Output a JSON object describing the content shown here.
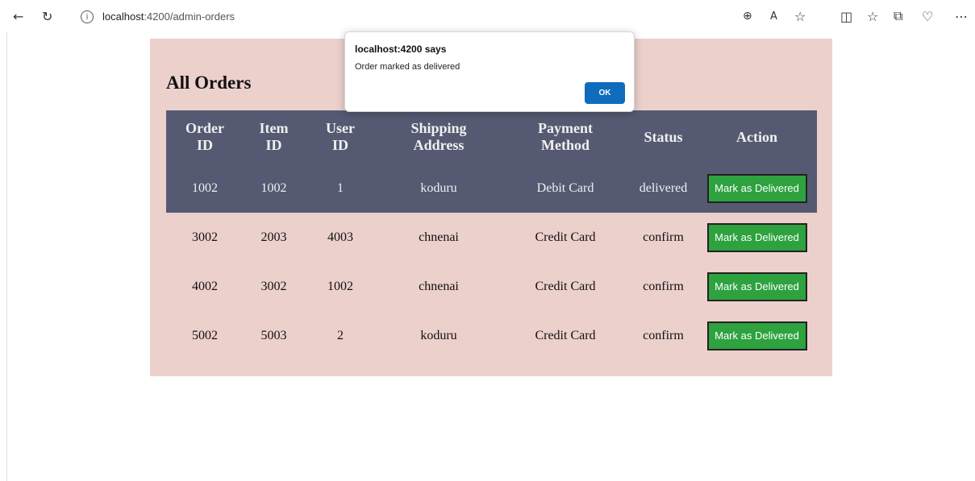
{
  "browser": {
    "url_host": "localhost",
    "url_rest": ":4200/admin-orders"
  },
  "page": {
    "heading": "All Orders"
  },
  "table": {
    "headers": [
      {
        "line1": "Order",
        "line2": "ID"
      },
      {
        "line1": "Item",
        "line2": "ID"
      },
      {
        "line1": "User",
        "line2": "ID"
      },
      {
        "line1": "Shipping",
        "line2": "Address"
      },
      {
        "line1": "Payment",
        "line2": "Method"
      },
      {
        "line1": "Status",
        "line2": ""
      },
      {
        "line1": "Action",
        "line2": ""
      }
    ],
    "rows": [
      {
        "order_id": "1002",
        "item_id": "1002",
        "user_id": "1",
        "address": "koduru",
        "payment": "Debit Card",
        "status": "delivered",
        "action": "Mark as Delivered"
      },
      {
        "order_id": "3002",
        "item_id": "2003",
        "user_id": "4003",
        "address": "chnenai",
        "payment": "Credit Card",
        "status": "confirm",
        "action": "Mark as Delivered"
      },
      {
        "order_id": "4002",
        "item_id": "3002",
        "user_id": "1002",
        "address": "chnenai",
        "payment": "Credit Card",
        "status": "confirm",
        "action": "Mark as Delivered"
      },
      {
        "order_id": "5002",
        "item_id": "5003",
        "user_id": "2",
        "address": "koduru",
        "payment": "Credit Card",
        "status": "confirm",
        "action": "Mark as Delivered"
      }
    ]
  },
  "dialog": {
    "title": "localhost:4200 says",
    "message": "Order marked as delivered",
    "ok_label": "OK"
  },
  "colors": {
    "card_bg": "#ecd0cc",
    "header_bg": "#555a72",
    "button_green": "#2ea23f",
    "ok_blue": "#0f6cbd"
  }
}
